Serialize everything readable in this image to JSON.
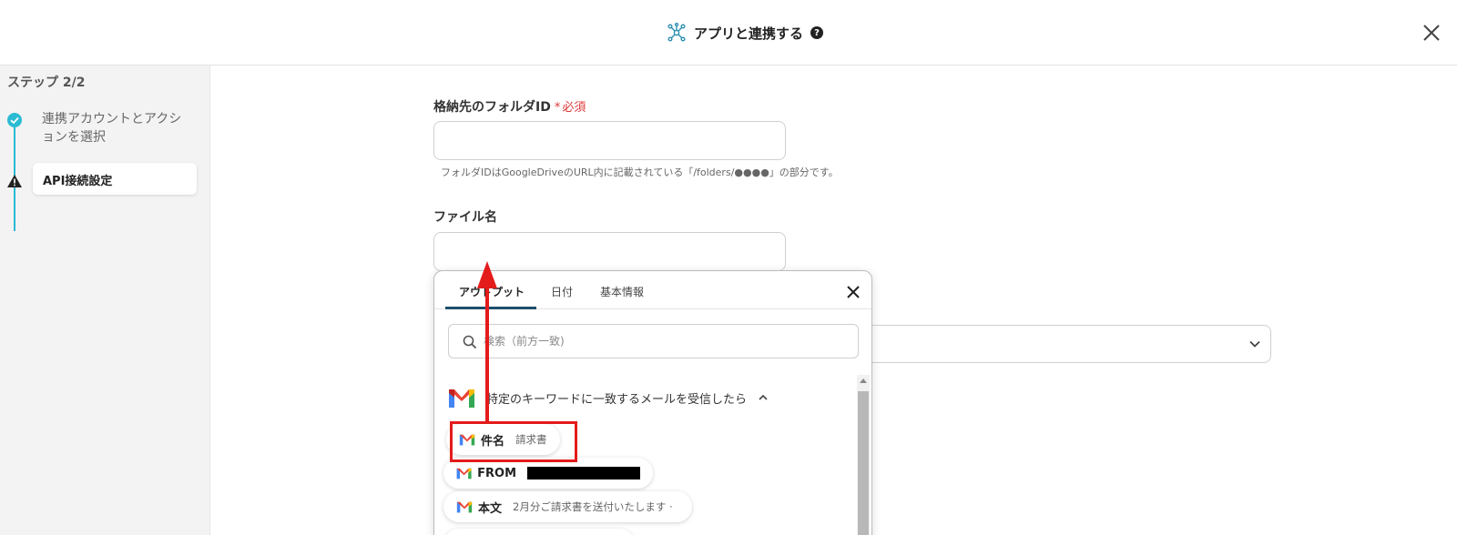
{
  "header": {
    "title": "アプリと連携する",
    "help_glyph": "?"
  },
  "sidebar": {
    "step_title": "ステップ 2/2",
    "steps": [
      {
        "label": "連携アカウントとアクションを選択",
        "status": "done"
      },
      {
        "label": "API接続設定",
        "status": "warning"
      }
    ]
  },
  "form": {
    "folder_id": {
      "label": "格納先のフォルダID",
      "required_mark": "*",
      "required_text": "必須",
      "value": "",
      "help": "フォルダIDはGoogleDriveのURL内に記載されている「/folders/●●●●」の部分です。"
    },
    "file_name": {
      "label": "ファイル名",
      "value": ""
    }
  },
  "popup": {
    "tabs": [
      {
        "label": "アウトプット",
        "active": true
      },
      {
        "label": "日付",
        "active": false
      },
      {
        "label": "基本情報",
        "active": false
      }
    ],
    "search": {
      "placeholder": "検索（前方一致)"
    },
    "group": {
      "icon": "gmail-icon",
      "title": "特定のキーワードに一致するメールを受信したら"
    },
    "items": [
      {
        "label": "件名",
        "value": "請求書",
        "highlighted": true
      },
      {
        "label": "FROM",
        "value": "",
        "redacted": true
      },
      {
        "label": "本文",
        "value": "2月分ご請求書を送付いたします ·"
      }
    ]
  },
  "colors": {
    "accent": "#2bbbd3",
    "annotation": "#e41b1b",
    "required": "#e03838",
    "tab_underline": "#1f4e6e"
  }
}
